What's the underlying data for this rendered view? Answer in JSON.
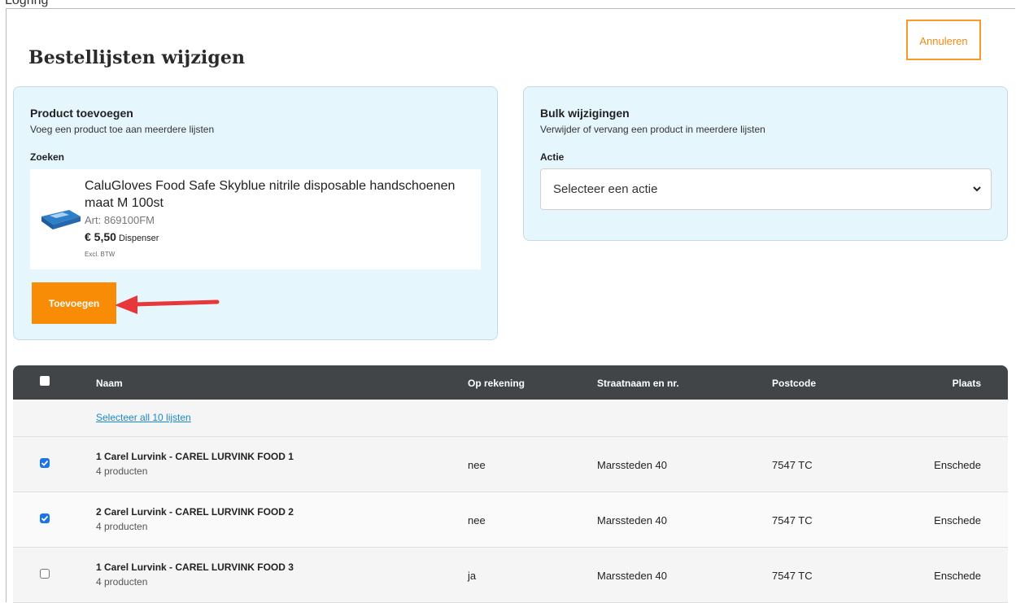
{
  "top_text": "Logring",
  "page": {
    "title": "Bestellijsten wijzigen",
    "cancel_label": "Annuleren"
  },
  "add_product": {
    "title": "Product toevoegen",
    "subtitle": "Voeg een product toe aan meerdere lijsten",
    "search_label": "Zoeken",
    "product": {
      "name": "CaluGloves Food Safe Skyblue nitrile disposable handschoenen maat M 100st",
      "art": "Art: 869100FM",
      "price": "€ 5,50",
      "unit": "Dispenser",
      "vat": "Excl. BTW"
    },
    "add_label": "Toevoegen"
  },
  "bulk": {
    "title": "Bulk wijzigingen",
    "subtitle": "Verwijder of vervang een product in meerdere lijsten",
    "action_label": "Actie",
    "select_value": "Selecteer een actie"
  },
  "table": {
    "headers": {
      "naam": "Naam",
      "rekening": "Op rekening",
      "straat": "Straatnaam en nr.",
      "postcode": "Postcode",
      "plaats": "Plaats"
    },
    "select_all": "Selecteer all 10 lijsten",
    "rows": [
      {
        "name": "1 Carel Lurvink - CAREL LURVINK FOOD 1",
        "count": "4 producten",
        "rekening": "nee",
        "straat": "Marssteden 40",
        "postcode": "7547 TC",
        "plaats": "Enschede",
        "checked": true
      },
      {
        "name": "2 Carel Lurvink - CAREL LURVINK FOOD 2",
        "count": "4 producten",
        "rekening": "nee",
        "straat": "Marssteden 40",
        "postcode": "7547 TC",
        "plaats": "Enschede",
        "checked": true
      },
      {
        "name": "1 Carel Lurvink - CAREL LURVINK FOOD 3",
        "count": "4 producten",
        "rekening": "ja",
        "straat": "Marssteden 40",
        "postcode": "7547 TC",
        "plaats": "Enschede",
        "checked": false
      }
    ]
  },
  "colors": {
    "accent": "#f98c06",
    "header_bg": "#414548",
    "card_bg": "#e6f6fd",
    "link": "#1a88c9",
    "check": "#1a73e8",
    "arrow": "#e8373b"
  }
}
